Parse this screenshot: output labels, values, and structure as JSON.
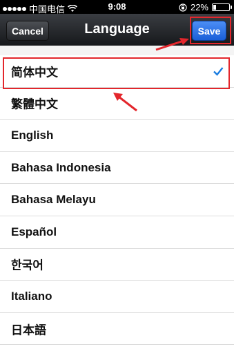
{
  "status_bar": {
    "carrier": "中国电信",
    "time": "9:08",
    "battery_percent": "22%",
    "battery_level": 0.22
  },
  "nav": {
    "cancel_label": "Cancel",
    "title": "Language",
    "save_label": "Save"
  },
  "languages": [
    {
      "label": "简体中文",
      "selected": true
    },
    {
      "label": "繁體中文",
      "selected": false
    },
    {
      "label": "English",
      "selected": false
    },
    {
      "label": "Bahasa Indonesia",
      "selected": false
    },
    {
      "label": "Bahasa Melayu",
      "selected": false
    },
    {
      "label": "Español",
      "selected": false
    },
    {
      "label": "한국어",
      "selected": false
    },
    {
      "label": "Italiano",
      "selected": false
    },
    {
      "label": "日本語",
      "selected": false
    }
  ],
  "colors": {
    "accent": "#1a7ce0",
    "annotation_red": "#e3262c"
  },
  "icons": {
    "signal": "signal-dots-icon",
    "wifi": "wifi-icon",
    "orientation_lock": "orientation-lock-icon",
    "battery": "battery-icon",
    "checkmark": "checkmark-icon"
  }
}
